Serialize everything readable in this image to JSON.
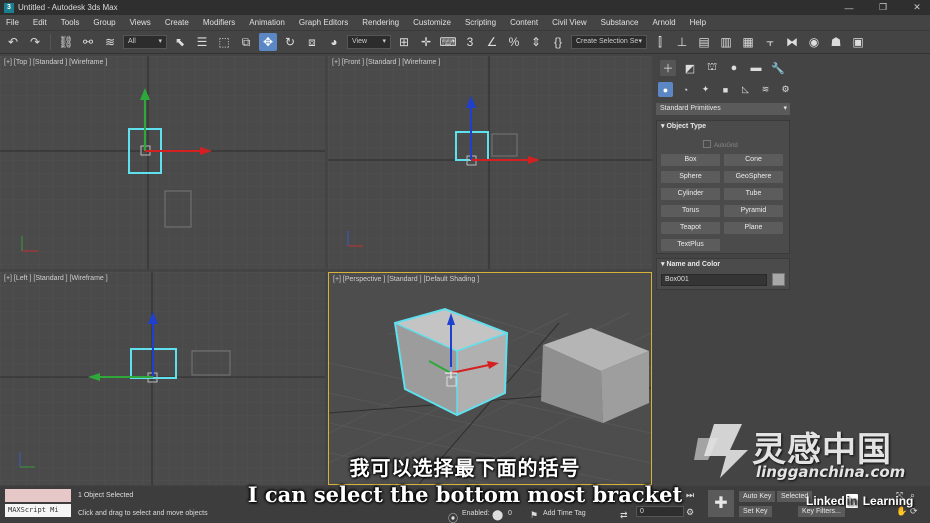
{
  "window": {
    "title": "Untitled - Autodesk 3ds Max",
    "app_icon": "3ds-max-logo-icon"
  },
  "menu": [
    "File",
    "Edit",
    "Tools",
    "Group",
    "Views",
    "Create",
    "Modifiers",
    "Animation",
    "Graph Editors",
    "Rendering",
    "Customize",
    "Scripting",
    "Content",
    "Civil View",
    "Substance",
    "Arnold",
    "Help"
  ],
  "toolbar": {
    "selection_filter": "All",
    "reference_coord": "View",
    "named_selection": "Create Selection Se",
    "active_tool": "move-icon"
  },
  "viewports": {
    "top_label": "[+] [Top ] [Standard ] [Wireframe ]",
    "front_label": "[+] [Front ] [Standard ] [Wireframe ]",
    "left_label": "[+] [Left ] [Standard ] [Wireframe ]",
    "perspective_label": "[+] [Perspective ] [Standard ] [Default Shading ]",
    "active": "perspective",
    "selection_color": "#5fe0ee",
    "active_border_color": "#d6b23a"
  },
  "command_panel": {
    "category_dropdown": "Standard Primitives",
    "object_type": {
      "title": "Object Type",
      "autogrid": "AutoGrid",
      "primitives": [
        "Box",
        "Cone",
        "Sphere",
        "GeoSphere",
        "Cylinder",
        "Tube",
        "Torus",
        "Pyramid",
        "Teapot",
        "Plane",
        "TextPlus"
      ]
    },
    "name_color": {
      "title": "Name and Color",
      "object_name": "Box001",
      "swatch_color": "#a8a8a8"
    }
  },
  "status_bar": {
    "maxscript_label": "MAXScript Mi",
    "selection_count": "1 Object Selected",
    "prompt": "Click and drag to select and move objects",
    "enabled_label": "Enabled:",
    "enabled_value": "0",
    "add_time_tag": "Add Time Tag",
    "frame_value": "0",
    "auto_key": "Auto Key",
    "selected": "Selected",
    "set_key": "Set Key",
    "key_filters": "Key Filters..."
  },
  "subtitles": {
    "chinese": "我可以选择最下面的括号",
    "english": "I can select the bottom most bracket"
  },
  "watermark": {
    "site_cn": "灵感中国",
    "site_en": "lingganchina.com",
    "linkedin": "Linked",
    "linkedin_in": "in",
    "learning": "Learning"
  }
}
